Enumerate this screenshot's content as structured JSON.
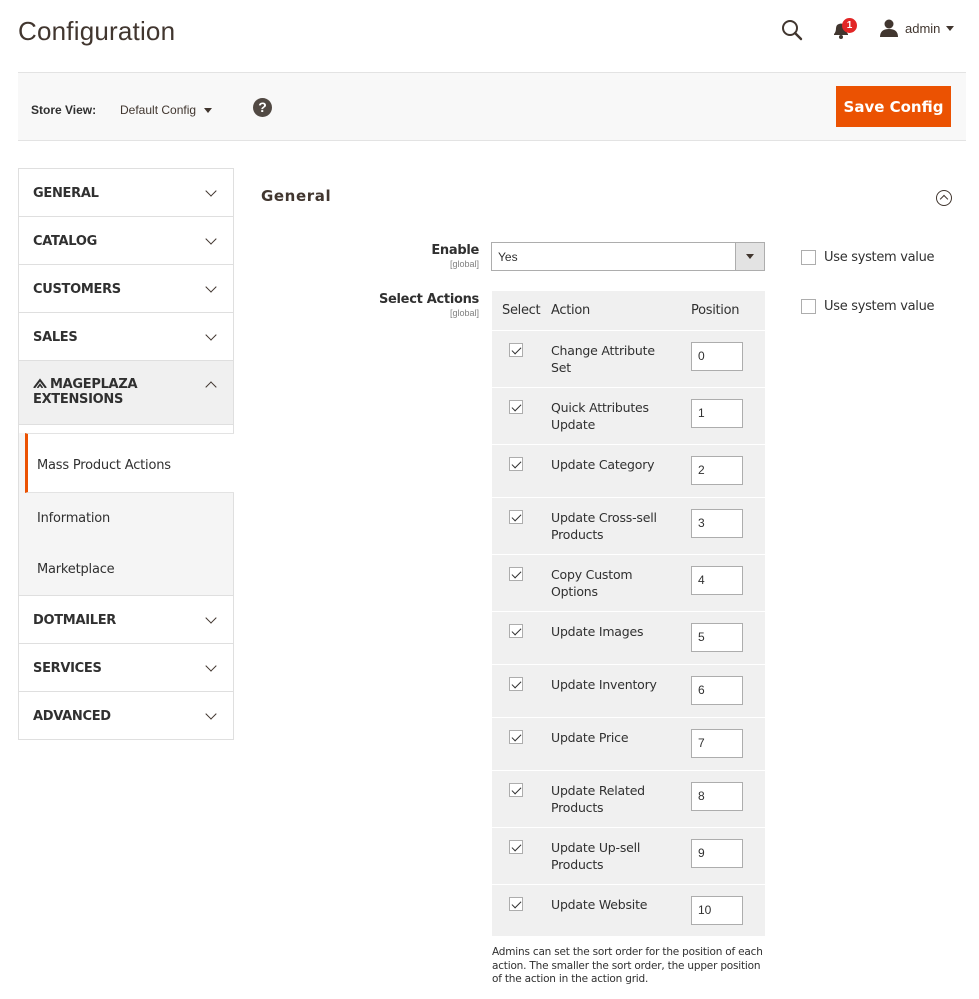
{
  "header": {
    "title": "Configuration",
    "notifications_count": "1",
    "user_name": "admin"
  },
  "store_bar": {
    "label": "Store View:",
    "selected": "Default Config",
    "help": "?",
    "save_label": "Save Config"
  },
  "sidebar": {
    "sections": [
      {
        "label": "GENERAL"
      },
      {
        "label": "CATALOG"
      },
      {
        "label": "CUSTOMERS"
      },
      {
        "label": "SALES"
      },
      {
        "label": "MAGEPLAZA EXTENSIONS",
        "line1": "MAGEPLAZA",
        "line2": "EXTENSIONS"
      },
      {
        "label": "DOTMAILER"
      },
      {
        "label": "SERVICES"
      },
      {
        "label": "ADVANCED"
      }
    ],
    "sub_items": [
      {
        "label": "Mass Product Actions",
        "active": true
      },
      {
        "label": "Information"
      },
      {
        "label": "Marketplace"
      }
    ]
  },
  "main": {
    "section_title": "General",
    "enable": {
      "label": "Enable",
      "scope": "[global]",
      "value": "Yes",
      "system_value_label": "Use system value"
    },
    "select_actions": {
      "label": "Select Actions",
      "scope": "[global]",
      "system_value_label": "Use system value",
      "columns": [
        "Select",
        "Action",
        "Position"
      ],
      "rows": [
        {
          "checked": true,
          "action": "Change Attribute Set",
          "l1": "Change Attribute",
          "l2": "Set",
          "position": "0"
        },
        {
          "checked": true,
          "action": "Quick Attributes Update",
          "l1": "Quick Attributes",
          "l2": "Update",
          "position": "1"
        },
        {
          "checked": true,
          "action": "Update Category",
          "l1": "Update Category",
          "l2": "",
          "position": "2"
        },
        {
          "checked": true,
          "action": "Update Cross-sell Products",
          "l1": "Update Cross-sell",
          "l2": "Products",
          "position": "3"
        },
        {
          "checked": true,
          "action": "Copy Custom Options",
          "l1": "Copy Custom",
          "l2": "Options",
          "position": "4"
        },
        {
          "checked": true,
          "action": "Update Images",
          "l1": "Update Images",
          "l2": "",
          "position": "5"
        },
        {
          "checked": true,
          "action": "Update Inventory",
          "l1": "Update Inventory",
          "l2": "",
          "position": "6"
        },
        {
          "checked": true,
          "action": "Update Price",
          "l1": "Update Price",
          "l2": "",
          "position": "7"
        },
        {
          "checked": true,
          "action": "Update Related Products",
          "l1": "Update Related",
          "l2": "Products",
          "position": "8"
        },
        {
          "checked": true,
          "action": "Update Up-sell Products",
          "l1": "Update Up-sell",
          "l2": "Products",
          "position": "9"
        },
        {
          "checked": true,
          "action": "Update Website",
          "l1": "Update Website",
          "l2": "",
          "position": "10"
        }
      ],
      "note": "Admins can set the sort order for the position of each action. The smaller the sort order, the upper position of the action in the action grid."
    }
  }
}
